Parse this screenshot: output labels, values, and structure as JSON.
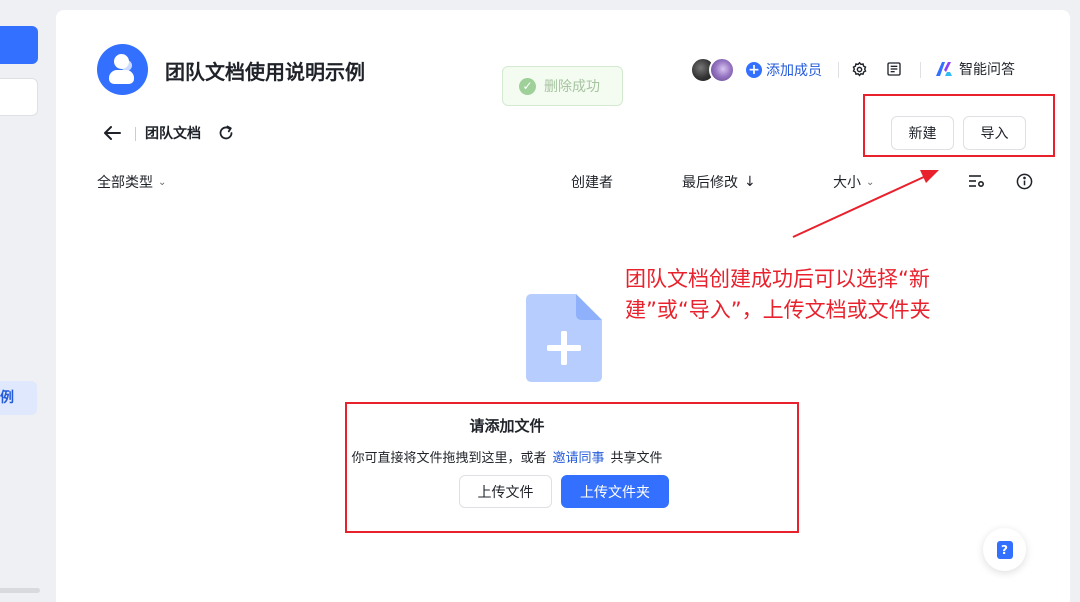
{
  "sidebar": {
    "active_item_label": "示例"
  },
  "header": {
    "title": "团队文档使用说明示例",
    "add_member_label": "添加成员",
    "ai_label": "智能问答"
  },
  "toast": {
    "message": "删除成功"
  },
  "breadcrumb": {
    "label": "团队文档"
  },
  "actions": {
    "new_label": "新建",
    "import_label": "导入"
  },
  "list_header": {
    "type_filter": "全部类型",
    "creator": "创建者",
    "last_modified": "最后修改",
    "size": "大小"
  },
  "empty_state": {
    "title": "请添加文件",
    "desc_prefix": "你可直接将文件拖拽到这里，或者",
    "invite_link": "邀请同事",
    "desc_suffix": "共享文件",
    "upload_file_label": "上传文件",
    "upload_folder_label": "上传文件夹"
  },
  "annotation": {
    "text": "团队文档创建成功后可以选择“新建”或“导入”，上传文档或文件夹"
  },
  "colors": {
    "primary": "#3370ff",
    "link": "#245bdb",
    "annotation_red": "#e8212c",
    "toast_bg": "#f4fbf1"
  }
}
